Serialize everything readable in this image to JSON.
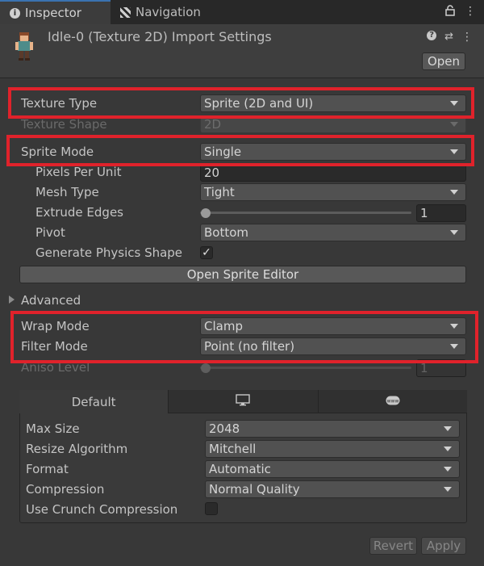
{
  "tabs": [
    {
      "label": "Inspector",
      "icon": "info-icon"
    },
    {
      "label": "Navigation",
      "icon": "navigation-icon"
    }
  ],
  "header": {
    "title": "Idle-0 (Texture 2D) Import Settings",
    "open_label": "Open",
    "icons": [
      "help-icon",
      "presets-icon",
      "more-icon"
    ]
  },
  "props": {
    "texture_type": {
      "label": "Texture Type",
      "value": "Sprite (2D and UI)"
    },
    "texture_shape": {
      "label": "Texture Shape",
      "value": "2D"
    },
    "sprite_mode": {
      "label": "Sprite Mode",
      "value": "Single"
    },
    "pixels_per_unit": {
      "label": "Pixels Per Unit",
      "value": "20"
    },
    "mesh_type": {
      "label": "Mesh Type",
      "value": "Tight"
    },
    "extrude_edges": {
      "label": "Extrude Edges",
      "value": "1",
      "slider_value": 1,
      "slider_max": 32
    },
    "pivot": {
      "label": "Pivot",
      "value": "Bottom"
    },
    "generate_physics": {
      "label": "Generate Physics Shape",
      "checked": true,
      "check_glyph": "✓"
    },
    "open_sprite_editor": "Open Sprite Editor",
    "advanced": "Advanced",
    "wrap_mode": {
      "label": "Wrap Mode",
      "value": "Clamp"
    },
    "filter_mode": {
      "label": "Filter Mode",
      "value": "Point (no filter)"
    },
    "aniso_level": {
      "label": "Aniso Level",
      "value": "1",
      "slider_value": 1,
      "slider_max": 16
    }
  },
  "platform": {
    "tabs": [
      {
        "label": "Default"
      },
      {
        "label": "",
        "icon": "monitor-icon"
      },
      {
        "label": "",
        "icon": "webgl-icon"
      }
    ],
    "max_size": {
      "label": "Max Size",
      "value": "2048"
    },
    "resize_algorithm": {
      "label": "Resize Algorithm",
      "value": "Mitchell"
    },
    "format": {
      "label": "Format",
      "value": "Automatic"
    },
    "compression": {
      "label": "Compression",
      "value": "Normal Quality"
    },
    "use_crunch": {
      "label": "Use Crunch Compression",
      "checked": false
    }
  },
  "footer": {
    "revert": "Revert",
    "apply": "Apply"
  },
  "colors": {
    "highlight": "#e0222b",
    "background": "#383838",
    "tab_accent": "#3a72b0"
  }
}
